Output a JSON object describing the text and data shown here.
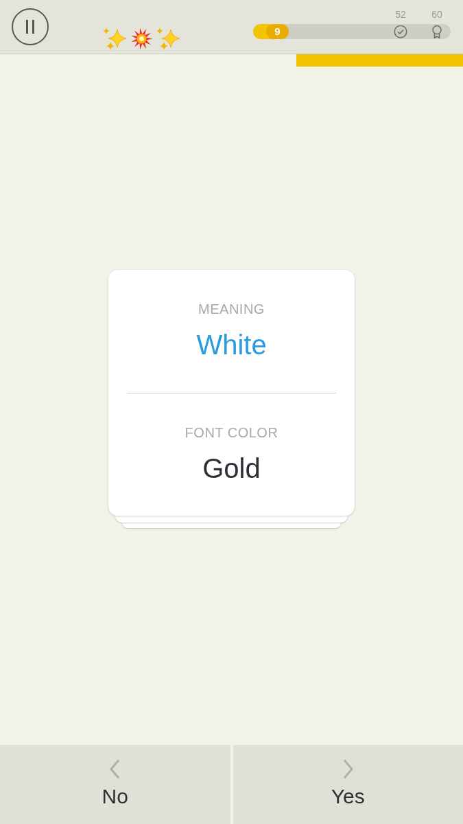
{
  "progress": {
    "level": 0.18,
    "score": "9",
    "milestones": [
      {
        "label": "52",
        "kind": "check"
      },
      {
        "label": "60",
        "kind": "medal"
      }
    ]
  },
  "timer": {
    "level": 0.36
  },
  "card": {
    "sections": [
      {
        "label": "MEANING",
        "value": "White",
        "color": "#2a9be0"
      },
      {
        "label": "FONT COLOR",
        "value": "Gold",
        "color": "#2b2f36"
      }
    ]
  },
  "answers": [
    {
      "label": "No",
      "kind": "prev"
    },
    {
      "label": "Yes",
      "kind": "next"
    }
  ]
}
